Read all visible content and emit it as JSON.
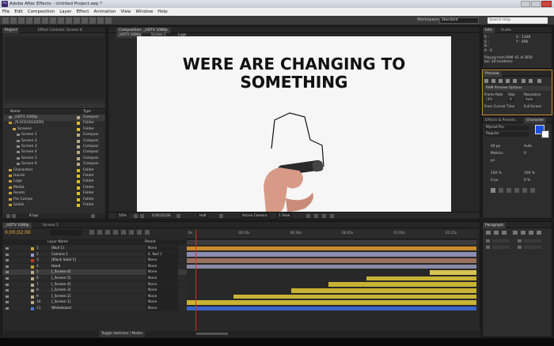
{
  "window": {
    "title": "Adobe After Effects - Untitled Project.aep *",
    "logo": "Ae"
  },
  "menu": [
    "File",
    "Edit",
    "Composition",
    "Layer",
    "Effect",
    "Animation",
    "View",
    "Window",
    "Help"
  ],
  "toolbar": {
    "workspace_label": "Workspace:",
    "workspace_value": "Standard",
    "search_placeholder": "Search Help"
  },
  "project": {
    "tabs": [
      "Project",
      "Effect Controls: Screen 6"
    ],
    "col_name": "Name",
    "col_type": "Type",
    "bpc": "8 bpc",
    "items": [
      {
        "name": "_HDTV 1080p",
        "type": "Composi",
        "color": "#b9a98a",
        "indent": 0,
        "icon": "comp"
      },
      {
        "name": "_PLACEHOLDERS",
        "type": "Folder",
        "color": "#e0c020",
        "indent": 0,
        "icon": "folder",
        "open": true
      },
      {
        "name": "Screens",
        "type": "Folder",
        "color": "#e0c020",
        "indent": 1,
        "icon": "folder",
        "open": true
      },
      {
        "name": "Screen 1",
        "type": "Composi",
        "color": "#b9a98a",
        "indent": 2,
        "icon": "comp"
      },
      {
        "name": "Screen 2",
        "type": "Composi",
        "color": "#b9a98a",
        "indent": 2,
        "icon": "comp"
      },
      {
        "name": "Screen 3",
        "type": "Composi",
        "color": "#b9a98a",
        "indent": 2,
        "icon": "comp"
      },
      {
        "name": "Screen 4",
        "type": "Composi",
        "color": "#b9a98a",
        "indent": 2,
        "icon": "comp"
      },
      {
        "name": "Screen 5",
        "type": "Composi",
        "color": "#b9a98a",
        "indent": 2,
        "icon": "comp"
      },
      {
        "name": "Screen 6",
        "type": "Composi",
        "color": "#b9a98a",
        "indent": 2,
        "icon": "comp"
      },
      {
        "name": "Characters",
        "type": "Folder",
        "color": "#e0c020",
        "indent": 0,
        "icon": "folder"
      },
      {
        "name": "Hands",
        "type": "Folder",
        "color": "#e0c020",
        "indent": 0,
        "icon": "folder"
      },
      {
        "name": "Logo",
        "type": "Folder",
        "color": "#e0c020",
        "indent": 0,
        "icon": "folder"
      },
      {
        "name": "Media",
        "type": "Folder",
        "color": "#e0c020",
        "indent": 0,
        "icon": "folder"
      },
      {
        "name": "Assets",
        "type": "Folder",
        "color": "#e0c020",
        "indent": 0,
        "icon": "folder"
      },
      {
        "name": "Pre Comps",
        "type": "Folder",
        "color": "#e0c020",
        "indent": 0,
        "icon": "folder"
      },
      {
        "name": "Solids",
        "type": "Folder",
        "color": "#e0c020",
        "indent": 0,
        "icon": "folder"
      }
    ]
  },
  "viewer": {
    "tab": "Composition: _HDTV 1080p",
    "breadcrumbs": [
      "_HDTV 1080p",
      "Screen 1",
      "Logo"
    ],
    "line1": "WERE ARE CHANGING TO SOMETHING",
    "line2": "SOMETHING",
    "footer": {
      "zoom": "50%",
      "timecode": "0;00;02;00",
      "resolution": "Half",
      "camera": "Active Camera",
      "views": "1 View"
    }
  },
  "info": {
    "tabs": [
      "Info",
      "Audio"
    ],
    "r": "R :",
    "g": "G :",
    "b": "B :",
    "a": "A : 0",
    "x": "X : 1308",
    "y": "Y : 498",
    "line1": "Playing from RAM: 61 of 2858",
    "line2": "fps: 28 (realtime)"
  },
  "preview": {
    "tab": "Preview",
    "ram_options": "RAM Preview Options",
    "frame_rate_label": "Frame Rate",
    "skip_label": "Skip",
    "resolution_label": "Resolution",
    "frame_rate": "(30)",
    "skip": "0",
    "resolution": "Auto",
    "from_current": "From Current Time",
    "full_screen": "Full Screen"
  },
  "character": {
    "tabs": [
      "Effects & Presets",
      "Character"
    ],
    "font": "Myriad Pro",
    "style": "Regular",
    "size": "40 px",
    "leading": "Auto",
    "tracking": "0",
    "kerning": "Metrics",
    "unit": "px",
    "scale_v": "100 %",
    "scale_h": "100 %",
    "baseline": "0 px",
    "tsume": "0 %"
  },
  "paragraph": {
    "tab": "Paragraph"
  },
  "timeline": {
    "tabs": [
      "_HDTV 1080p",
      "Screen 1"
    ],
    "timecode": "0;00;02;00",
    "col_layer": "Layer Name",
    "col_parent": "Parent",
    "footer": "Toggle Switches / Modes",
    "ruler": [
      "0s",
      "00:15s",
      "00:30s",
      "00:45s",
      "01:00s",
      "01:15s"
    ],
    "layers": [
      {
        "num": "1",
        "name": "[Null 1]",
        "label": "#c7a23a",
        "parent": "None"
      },
      {
        "num": "2",
        "name": "Camera 1",
        "label": "#9a9ad0",
        "parent": "6. Null 1"
      },
      {
        "num": "3",
        "name": "[Black Solid 1]",
        "label": "#c0392b",
        "parent": "None"
      },
      {
        "num": "4",
        "name": "Hand",
        "label": "#c7a23a",
        "parent": "None"
      },
      {
        "num": "5",
        "name": "[_Screen 6]",
        "label": "#b9a98a",
        "parent": "None"
      },
      {
        "num": "6",
        "name": "[_Screen 5]",
        "label": "#b9a98a",
        "parent": "None"
      },
      {
        "num": "7",
        "name": "[_Screen 4]",
        "label": "#b9a98a",
        "parent": "None"
      },
      {
        "num": "8",
        "name": "[_Screen 3]",
        "label": "#b9a98a",
        "parent": "None"
      },
      {
        "num": "9",
        "name": "[_Screen 2]",
        "label": "#b9a98a",
        "parent": "None"
      },
      {
        "num": "10",
        "name": "[_Screen 1]",
        "label": "#b9a98a",
        "parent": "None"
      },
      {
        "num": "11",
        "name": "Whiteboard",
        "label": "#4a7ad0",
        "parent": "None"
      }
    ],
    "bars": [
      {
        "start": 0.0,
        "end": 1.0,
        "color": "#c98a2b"
      },
      {
        "start": 0.0,
        "end": 1.0,
        "color": "#8c8cb4"
      },
      {
        "start": 0.0,
        "end": 1.0,
        "color": "#9a7060"
      },
      {
        "start": 0.0,
        "end": 1.0,
        "color": "#8a8aa6"
      },
      {
        "start": 0.84,
        "end": 1.0,
        "color": "#d8c452"
      },
      {
        "start": 0.62,
        "end": 1.0,
        "color": "#c9b334"
      },
      {
        "start": 0.49,
        "end": 1.0,
        "color": "#c9b334"
      },
      {
        "start": 0.36,
        "end": 1.0,
        "color": "#c9b334"
      },
      {
        "start": 0.16,
        "end": 1.0,
        "color": "#c9b334"
      },
      {
        "start": 0.0,
        "end": 1.0,
        "color": "#c9b334"
      },
      {
        "start": 0.0,
        "end": 1.0,
        "color": "#3a64c8"
      }
    ],
    "playhead": 0.03
  },
  "colors": {
    "accent": "#f0b33a",
    "playhead": "#d03020"
  }
}
